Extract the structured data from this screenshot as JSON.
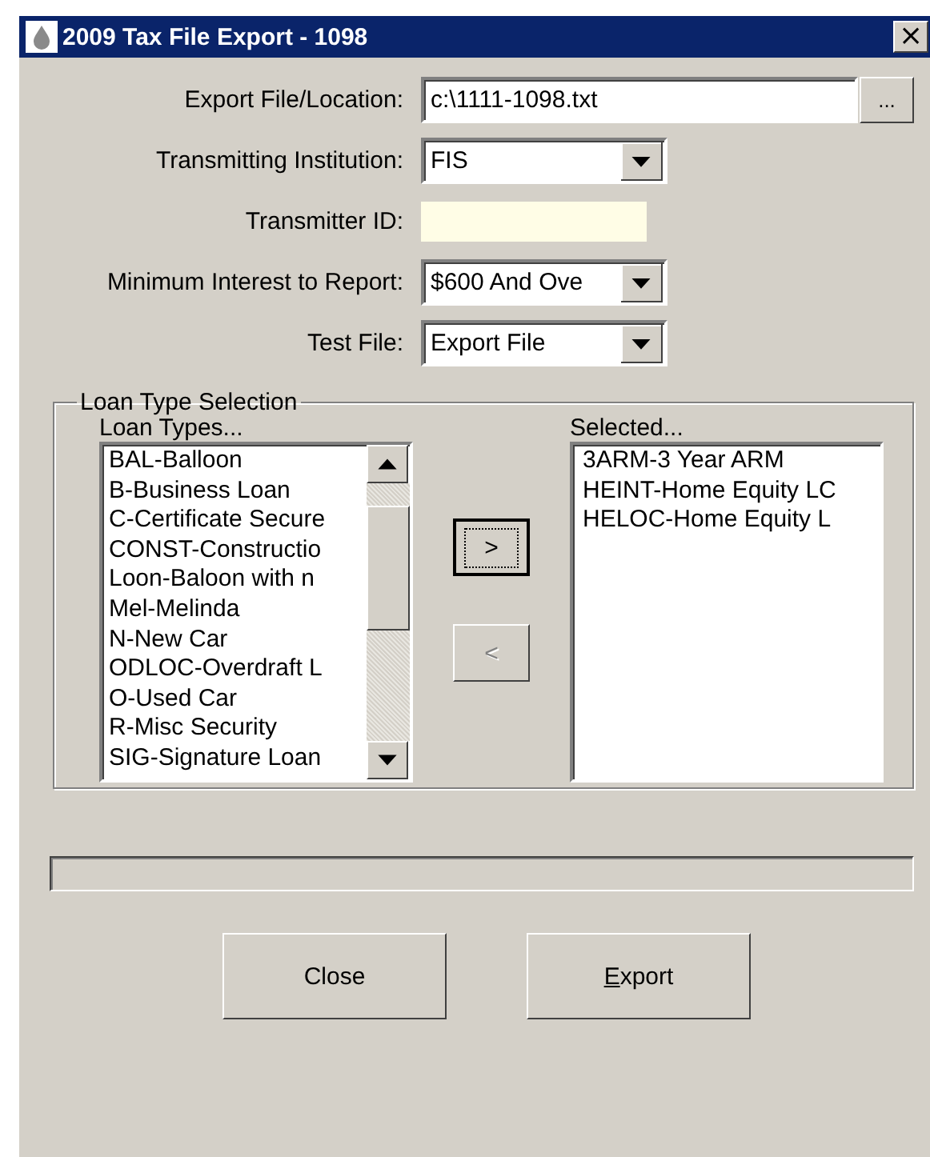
{
  "window": {
    "title": "2009 Tax File Export - 1098",
    "close": "×"
  },
  "form": [
    {
      "kind": "file",
      "label": "Export File/Location:",
      "value": "c:\\1111-1098.txt",
      "button": "..."
    },
    {
      "kind": "dropdown",
      "label": "Transmitting Institution:",
      "value": "FIS"
    },
    {
      "kind": "text",
      "label": "Transmitter ID:"
    },
    {
      "kind": "dropdown",
      "label": "Minimum Interest to Report:",
      "value": "$600 And Ove"
    },
    {
      "kind": "dropdown",
      "label": "Test File:",
      "value": "Export File"
    }
  ],
  "loan_type_selection": {
    "title": "Loan Type Selection",
    "available": {
      "label": "Loan Types...",
      "items": [
        "BAL-Balloon",
        "B-Business Loan",
        "C-Certificate Secure",
        "CONST-Constructio",
        "Loon-Baloon with n",
        "Mel-Melinda",
        "N-New Car",
        "ODLOC-Overdraft L",
        "O-Used Car",
        "R-Misc Security",
        "SIG-Signature Loan"
      ]
    },
    "add_button": {
      "label": ">",
      "disabled": false,
      "focused": true
    },
    "remove_button": {
      "label": "<",
      "disabled": true,
      "focused": false
    },
    "selected": {
      "label": "Selected...",
      "items": [
        "3ARM-3 Year ARM",
        "HEINT-Home Equity LC",
        "HELOC-Home Equity L"
      ]
    }
  },
  "progress": {
    "level": 0
  },
  "buttons": [
    {
      "label": "Close"
    },
    {
      "label": "Export"
    }
  ]
}
